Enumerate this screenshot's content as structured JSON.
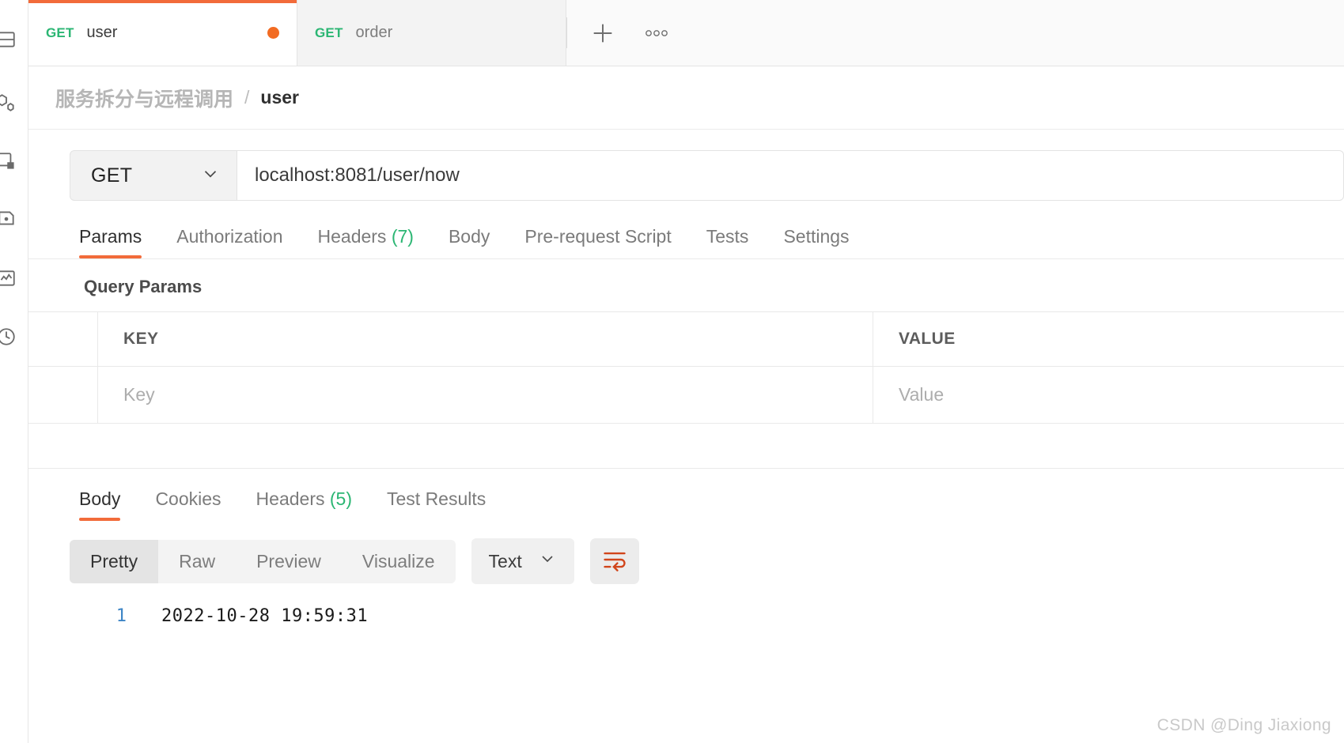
{
  "sidebar": {
    "items": [
      {
        "name": "collections-icon",
        "label": "Collections"
      },
      {
        "name": "apis-icon",
        "label": "APIs"
      },
      {
        "name": "environments-icon",
        "label": "Environments"
      },
      {
        "name": "mock-servers-icon",
        "label": "Mock Servers"
      },
      {
        "name": "monitors-icon",
        "label": "Monitors"
      },
      {
        "name": "history-icon",
        "label": "History"
      }
    ]
  },
  "tabs": {
    "items": [
      {
        "method": "GET",
        "name": "user",
        "active": true,
        "unsaved": true
      },
      {
        "method": "GET",
        "name": "order",
        "active": false,
        "unsaved": false
      }
    ],
    "new_tab_label": "+",
    "more_label": "ooo"
  },
  "breadcrumb": {
    "parent": "服务拆分与远程调用",
    "separator": "/",
    "current": "user"
  },
  "request": {
    "method": "GET",
    "url": "localhost:8081/user/now",
    "tabs": [
      {
        "label": "Params",
        "count": "",
        "active": true
      },
      {
        "label": "Authorization",
        "count": "",
        "active": false
      },
      {
        "label": "Headers",
        "count": "(7)",
        "active": false
      },
      {
        "label": "Body",
        "count": "",
        "active": false
      },
      {
        "label": "Pre-request Script",
        "count": "",
        "active": false
      },
      {
        "label": "Tests",
        "count": "",
        "active": false
      },
      {
        "label": "Settings",
        "count": "",
        "active": false
      }
    ],
    "query_params": {
      "section_title": "Query Params",
      "columns": [
        "KEY",
        "VALUE"
      ],
      "rows": [
        {
          "key_placeholder": "Key",
          "value_placeholder": "Value"
        }
      ]
    }
  },
  "response": {
    "tabs": [
      {
        "label": "Body",
        "count": "",
        "active": true
      },
      {
        "label": "Cookies",
        "count": "",
        "active": false
      },
      {
        "label": "Headers",
        "count": "(5)",
        "active": false
      },
      {
        "label": "Test Results",
        "count": "",
        "active": false
      }
    ],
    "view_modes": [
      {
        "label": "Pretty",
        "active": true
      },
      {
        "label": "Raw",
        "active": false
      },
      {
        "label": "Preview",
        "active": false
      },
      {
        "label": "Visualize",
        "active": false
      }
    ],
    "format": "Text",
    "body_lines": [
      {
        "no": "1",
        "text": "2022-10-28 19:59:31"
      }
    ]
  },
  "watermark": "CSDN @Ding Jiaxiong",
  "colors": {
    "accent": "#f26b3a",
    "method_get": "#2bb673",
    "unsaved_dot": "#f26b22",
    "line_number": "#3d85c6",
    "wrap_icon": "#d1451b"
  }
}
